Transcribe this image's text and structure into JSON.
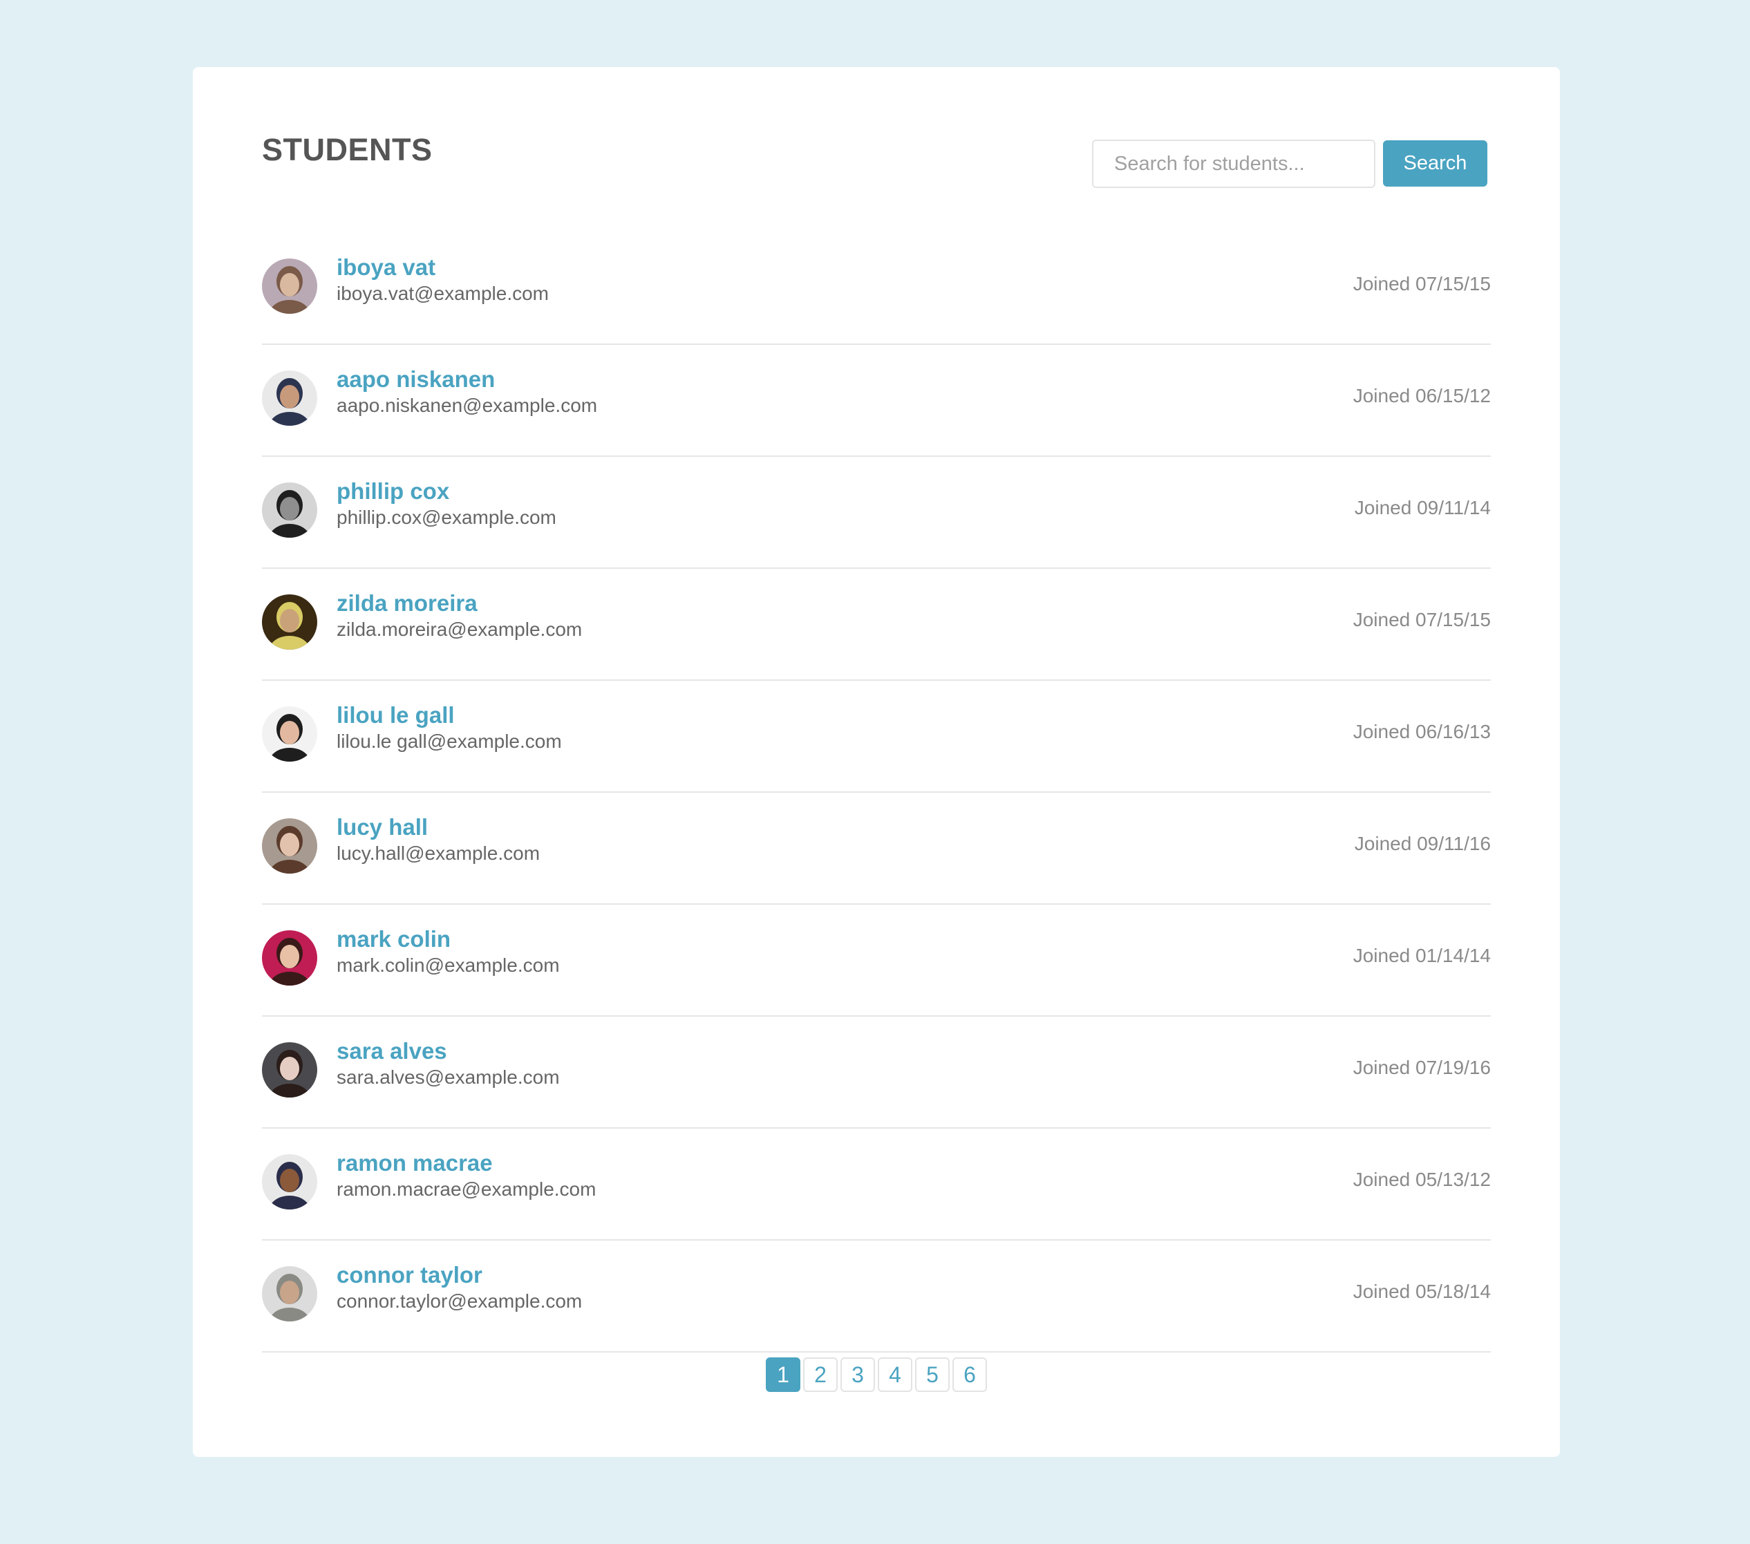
{
  "header": {
    "title": "STUDENTS",
    "search_placeholder": "Search for students...",
    "search_button_label": "Search"
  },
  "colors": {
    "background": "#e1f0f5",
    "accent": "#4aa3c1",
    "card": "#ffffff"
  },
  "students": [
    {
      "name": "iboya vat",
      "email": "iboya.vat@example.com",
      "joined": "Joined 07/15/15",
      "avatar": "woman-photo-avatar",
      "avatar_colors": [
        "#b9a9b4",
        "#7a5a48",
        "#d9b9a0"
      ]
    },
    {
      "name": "aapo niskanen",
      "email": "aapo.niskanen@example.com",
      "joined": "Joined 06/15/12",
      "avatar": "man-photo-avatar",
      "avatar_colors": [
        "#e9e9e9",
        "#2c3550",
        "#c89a7c"
      ]
    },
    {
      "name": "phillip cox",
      "email": "phillip.cox@example.com",
      "joined": "Joined 09/11/14",
      "avatar": "man-photo-avatar",
      "avatar_colors": [
        "#d5d5d5",
        "#1f1f1f",
        "#8f8f8f"
      ]
    },
    {
      "name": "zilda moreira",
      "email": "zilda.moreira@example.com",
      "joined": "Joined 07/15/15",
      "avatar": "woman-photo-avatar",
      "avatar_colors": [
        "#3a2a12",
        "#d9cc66",
        "#c9a27a"
      ]
    },
    {
      "name": "lilou le gall",
      "email": "lilou.le gall@example.com",
      "joined": "Joined 06/16/13",
      "avatar": "woman-photo-avatar",
      "avatar_colors": [
        "#f2f2f2",
        "#1e1e1e",
        "#e2b9a0"
      ]
    },
    {
      "name": "lucy hall",
      "email": "lucy.hall@example.com",
      "joined": "Joined 09/11/16",
      "avatar": "woman-photo-avatar",
      "avatar_colors": [
        "#a79a90",
        "#5b3c2c",
        "#e3c2ad"
      ]
    },
    {
      "name": "mark colin",
      "email": "mark.colin@example.com",
      "joined": "Joined 01/14/14",
      "avatar": "woman-photo-avatar",
      "avatar_colors": [
        "#c01d54",
        "#3a1a18",
        "#e8c0a5"
      ]
    },
    {
      "name": "sara alves",
      "email": "sara.alves@example.com",
      "joined": "Joined 07/19/16",
      "avatar": "woman-photo-avatar",
      "avatar_colors": [
        "#4a4a4e",
        "#2a1d1a",
        "#e6cdc4"
      ]
    },
    {
      "name": "ramon macrae",
      "email": "ramon.macrae@example.com",
      "joined": "Joined 05/13/12",
      "avatar": "man-photo-avatar",
      "avatar_colors": [
        "#e8e8e8",
        "#2a2e4a",
        "#8a5a3a"
      ]
    },
    {
      "name": "connor taylor",
      "email": "connor.taylor@example.com",
      "joined": "Joined 05/18/14",
      "avatar": "man-photo-avatar",
      "avatar_colors": [
        "#dcdcdc",
        "#8a8a84",
        "#c8a48a"
      ]
    }
  ],
  "pagination": {
    "pages": [
      "1",
      "2",
      "3",
      "4",
      "5",
      "6"
    ],
    "active": "1"
  }
}
